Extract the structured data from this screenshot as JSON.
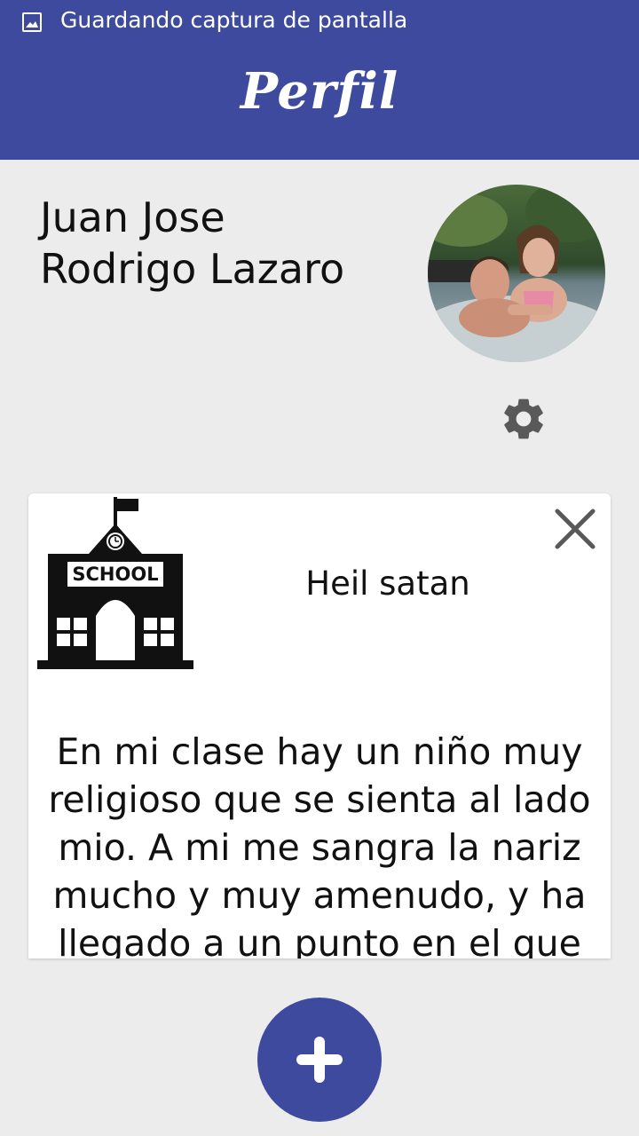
{
  "status_bar": {
    "notification_icon": "image-icon",
    "text": "Guardando captura de pantalla"
  },
  "header": {
    "title": "Perfil"
  },
  "profile": {
    "name_line1": "Juan Jose",
    "name_line2": "Rodrigo Lazaro",
    "avatar": "profile-photo",
    "settings_icon": "gear-icon"
  },
  "post_card": {
    "category_icon": "school-icon",
    "category_label": "SCHOOL",
    "title": "Heil satan",
    "close_icon": "close-icon",
    "body_lines": [
      "En mi clase hay un niño muy",
      "religioso que se sienta al lado",
      "mio. A mi me sangra la nariz",
      "mucho y muy amenudo, y ha",
      "llegado a un punto en el que"
    ]
  },
  "fab": {
    "icon": "plus-icon"
  },
  "colors": {
    "primary": "#3e4a9e",
    "background": "#ececec",
    "card": "#ffffff",
    "icon_gray": "#595959"
  }
}
